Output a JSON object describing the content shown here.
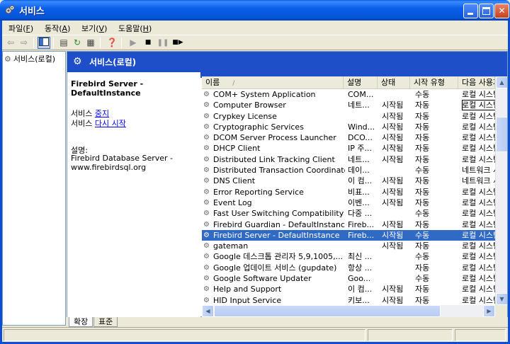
{
  "window": {
    "title": "서비스"
  },
  "menu": [
    {
      "label": "파일",
      "key": "F"
    },
    {
      "label": "동작",
      "key": "A"
    },
    {
      "label": "보기",
      "key": "V"
    },
    {
      "label": "도움말",
      "key": "H"
    }
  ],
  "toolbar": {
    "icons": [
      "back-icon",
      "forward-icon",
      "show-hide-tree-icon",
      "properties-icon",
      "refresh-icon",
      "export-list-icon",
      "help-icon",
      "start-icon",
      "stop-icon",
      "pause-icon",
      "restart-icon"
    ]
  },
  "tree": {
    "label": "서비스(로컬)"
  },
  "banner": {
    "title": "서비스(로컬)"
  },
  "detail": {
    "service_title": "Firebird Server - DefaultInstance",
    "action_prefix": "서비스 ",
    "stop_link": "중지",
    "restart_link": "다시 시작",
    "desc_label": "설명:",
    "desc_text": "Firebird Database Server - www.firebirdsql.org"
  },
  "columns": {
    "name": "이름",
    "desc": "설명",
    "status": "상태",
    "startup": "시작 유형",
    "logon": "다음 사용자"
  },
  "services": [
    {
      "name": "COM+ System Application",
      "desc": "COM...",
      "status": "",
      "startup": "수동",
      "logon": "로컬 시스템"
    },
    {
      "name": "Computer Browser",
      "desc": "네트...",
      "status": "시작됨",
      "startup": "자동",
      "logon": "로컬 시스템"
    },
    {
      "name": "Crypkey License",
      "desc": "",
      "status": "시작됨",
      "startup": "자동",
      "logon": "로컬 시스템"
    },
    {
      "name": "Cryptographic Services",
      "desc": "Wind...",
      "status": "시작됨",
      "startup": "자동",
      "logon": "로컬 시스템"
    },
    {
      "name": "DCOM Server Process Launcher",
      "desc": "DCO...",
      "status": "시작됨",
      "startup": "자동",
      "logon": "로컬 시스템"
    },
    {
      "name": "DHCP Client",
      "desc": "IP 주...",
      "status": "시작됨",
      "startup": "자동",
      "logon": "로컬 시스템"
    },
    {
      "name": "Distributed Link Tracking Client",
      "desc": "네트...",
      "status": "시작됨",
      "startup": "자동",
      "logon": "로컬 시스템"
    },
    {
      "name": "Distributed Transaction Coordinator",
      "desc": "데이...",
      "status": "",
      "startup": "수동",
      "logon": "네트워크 서비스"
    },
    {
      "name": "DNS Client",
      "desc": "이 컴...",
      "status": "시작됨",
      "startup": "자동",
      "logon": "네트워크 서비스"
    },
    {
      "name": "Error Reporting Service",
      "desc": "비표...",
      "status": "시작됨",
      "startup": "자동",
      "logon": "로컬 시스템"
    },
    {
      "name": "Event Log",
      "desc": "이벤...",
      "status": "시작됨",
      "startup": "자동",
      "logon": "로컬 시스템"
    },
    {
      "name": "Fast User Switching Compatibility",
      "desc": "다중 ...",
      "status": "",
      "startup": "수동",
      "logon": "로컬 시스템"
    },
    {
      "name": "Firebird Guardian - DefaultInstance",
      "desc": "Fireb...",
      "status": "시작됨",
      "startup": "자동",
      "logon": "로컬 시스템"
    },
    {
      "name": "Firebird Server - DefaultInstance",
      "desc": "Fireb...",
      "status": "시작됨",
      "startup": "수동",
      "logon": "로컬 시스템",
      "selected": true
    },
    {
      "name": "gateman",
      "desc": "",
      "status": "시작됨",
      "startup": "자동",
      "logon": "로컬 시스템"
    },
    {
      "name": "Google 데스크톱 관리자 5,9,1005,...",
      "desc": "최신 ...",
      "status": "",
      "startup": "수동",
      "logon": "로컬 시스템"
    },
    {
      "name": "Google 업데이트 서비스 (gupdate)",
      "desc": "항상 ...",
      "status": "",
      "startup": "자동",
      "logon": "로컬 시스템"
    },
    {
      "name": "Google Software Updater",
      "desc": "Goo...",
      "status": "",
      "startup": "수동",
      "logon": "로컬 시스템"
    },
    {
      "name": "Help and Support",
      "desc": "이 컴...",
      "status": "시작됨",
      "startup": "자동",
      "logon": "로컬 시스템"
    },
    {
      "name": "HID Input Service",
      "desc": "키보...",
      "status": "시작됨",
      "startup": "자동",
      "logon": "로컬 시스템"
    }
  ],
  "tabs": {
    "extended": "확장",
    "standard": "표준"
  }
}
